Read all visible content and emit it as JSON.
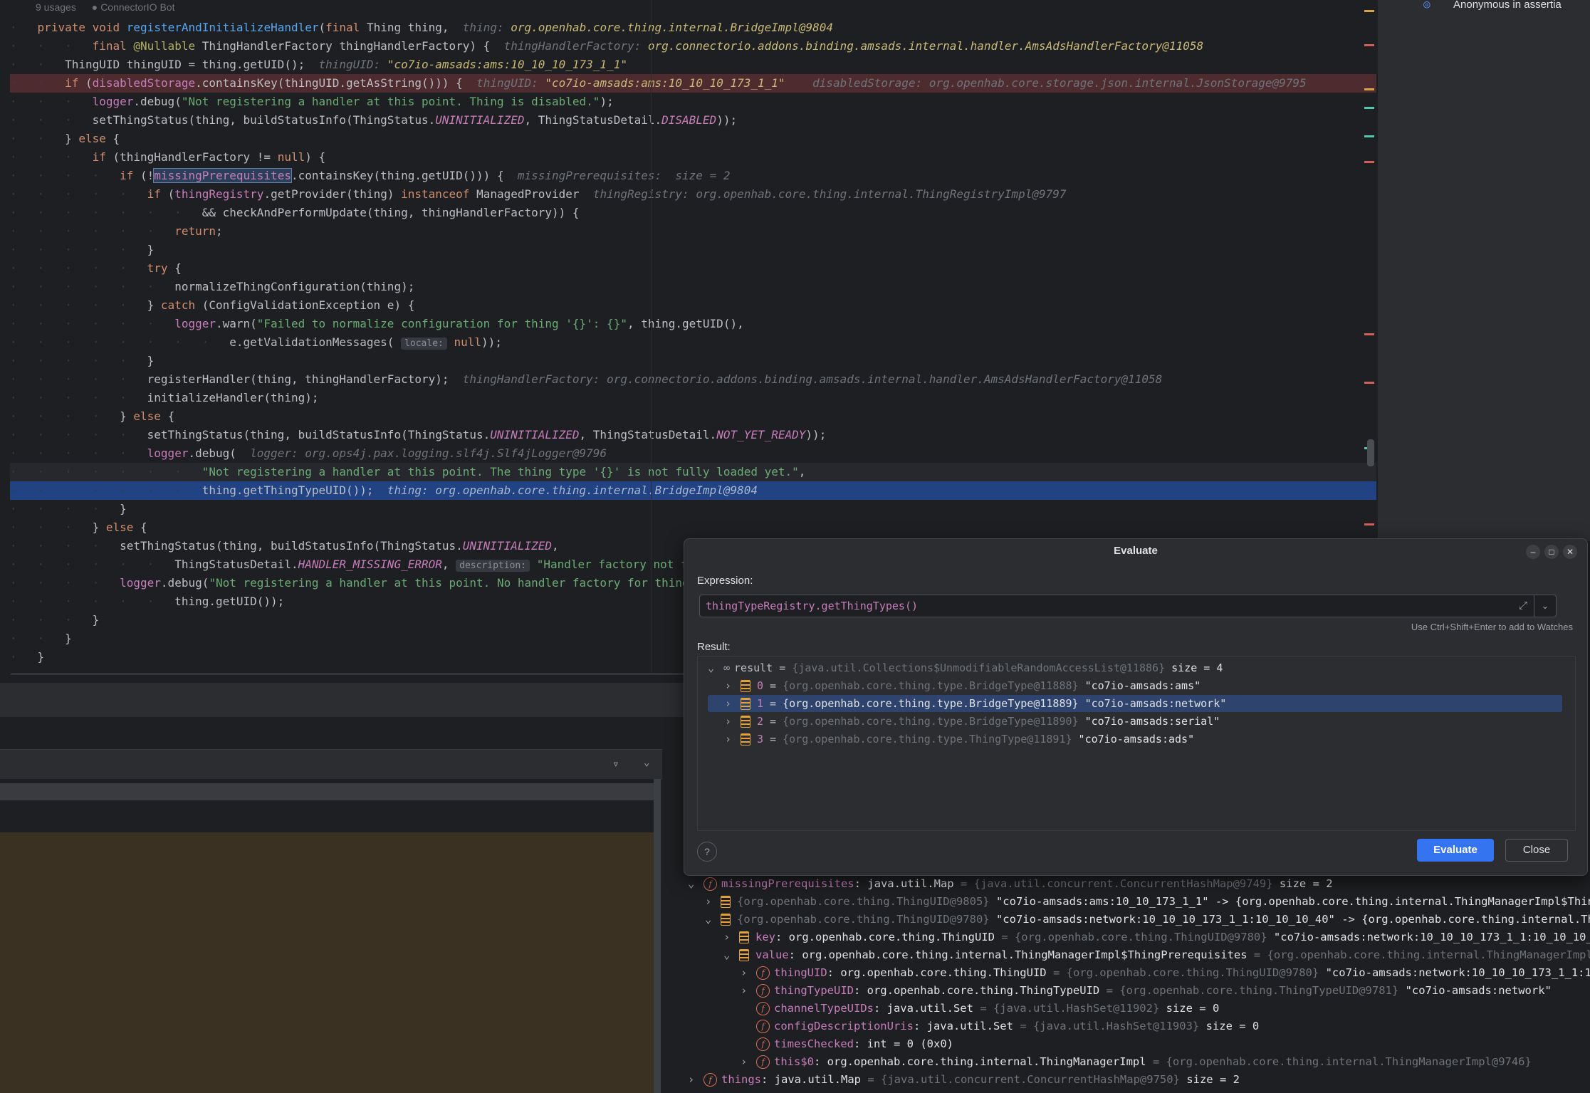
{
  "editor": {
    "meta": {
      "usages": "9 usages",
      "author": "ConnectorIO Bot"
    }
  },
  "right_panel": {
    "text": "Anonymous in assertia"
  },
  "evaluate_dialog": {
    "title": "Evaluate",
    "expression_label": "Expression:",
    "expression": "thingTypeRegistry.getThingTypes()",
    "watch_hint": "Use Ctrl+Shift+Enter to add to Watches",
    "result_label": "Result:",
    "result": {
      "name": "result",
      "ref": "{java.util.Collections$UnmodifiableRandomAccessList@11886}",
      "size": "size = 4",
      "items": [
        {
          "index": "0",
          "ref": "{org.openhab.core.thing.type.BridgeType@11888}",
          "value": "\"co7io-amsads:ams\""
        },
        {
          "index": "1",
          "ref": "{org.openhab.core.thing.type.BridgeType@11889}",
          "value": "\"co7io-amsads:network\""
        },
        {
          "index": "2",
          "ref": "{org.openhab.core.thing.type.BridgeType@11890}",
          "value": "\"co7io-amsads:serial\""
        },
        {
          "index": "3",
          "ref": "{org.openhab.core.thing.type.ThingType@11891}",
          "value": "\"co7io-amsads:ads\""
        }
      ]
    },
    "help": "?",
    "evaluate_button": "Evaluate",
    "close_button": "Close"
  },
  "variables": [
    {
      "name": "missingPrerequisites",
      "type": ": java.util.Map",
      "ref": "= {java.util.concurrent.ConcurrentHashMap@9749}",
      "value": "size = 2"
    },
    {
      "name": "{org.openhab.core.thing.ThingUID@9805}",
      "type": "",
      "ref": "",
      "value": "\"co7io-amsads:ams:10_10_173_1_1\" -> {org.openhab.core.thing.internal.ThingManagerImpl$Thin"
    },
    {
      "name": "{org.openhab.core.thing.ThingUID@9780}",
      "type": "",
      "ref": "",
      "value": "\"co7io-amsads:network:10_10_10_173_1_1:10_10_10_40\" -> {org.openhab.core.thing.internal.ThingM"
    },
    {
      "name": "key",
      "type": ": org.openhab.core.thing.ThingUID",
      "ref": "= {org.openhab.core.thing.ThingUID@9780}",
      "value": "\"co7io-amsads:network:10_10_10_173_1_1:10_10_10_40\""
    },
    {
      "name": "value",
      "type": ": org.openhab.core.thing.internal.ThingManagerImpl$ThingPrerequisites",
      "ref": "= {org.openhab.core.thing.internal.ThingManagerImpl$Thi",
      "value": ""
    },
    {
      "name": "thingUID",
      "type": ": org.openhab.core.thing.ThingUID",
      "ref": "= {org.openhab.core.thing.ThingUID@9780}",
      "value": "\"co7io-amsads:network:10_10_10_173_1_1:10_10_1"
    },
    {
      "name": "thingTypeUID",
      "type": ": org.openhab.core.thing.ThingTypeUID",
      "ref": "= {org.openhab.core.thing.ThingTypeUID@9781}",
      "value": "\"co7io-amsads:network\""
    },
    {
      "name": "channelTypeUIDs",
      "type": ": java.util.Set",
      "ref": "= {java.util.HashSet@11902}",
      "value": "size = 0"
    },
    {
      "name": "configDescriptionUris",
      "type": ": java.util.Set",
      "ref": "= {java.util.HashSet@11903}",
      "value": "size = 0"
    },
    {
      "name": "timesChecked",
      "type": ": int",
      "ref": "= 0 (0x0)",
      "value": ""
    },
    {
      "name": "this$0",
      "type": ": org.openhab.core.thing.internal.ThingManagerImpl",
      "ref": "= {org.openhab.core.thing.internal.ThingManagerImpl@9746}",
      "value": ""
    },
    {
      "name": "things",
      "type": ": java.util.Map",
      "ref": "= {java.util.concurrent.ConcurrentHashMap@9750}",
      "value": "size = 2"
    }
  ]
}
